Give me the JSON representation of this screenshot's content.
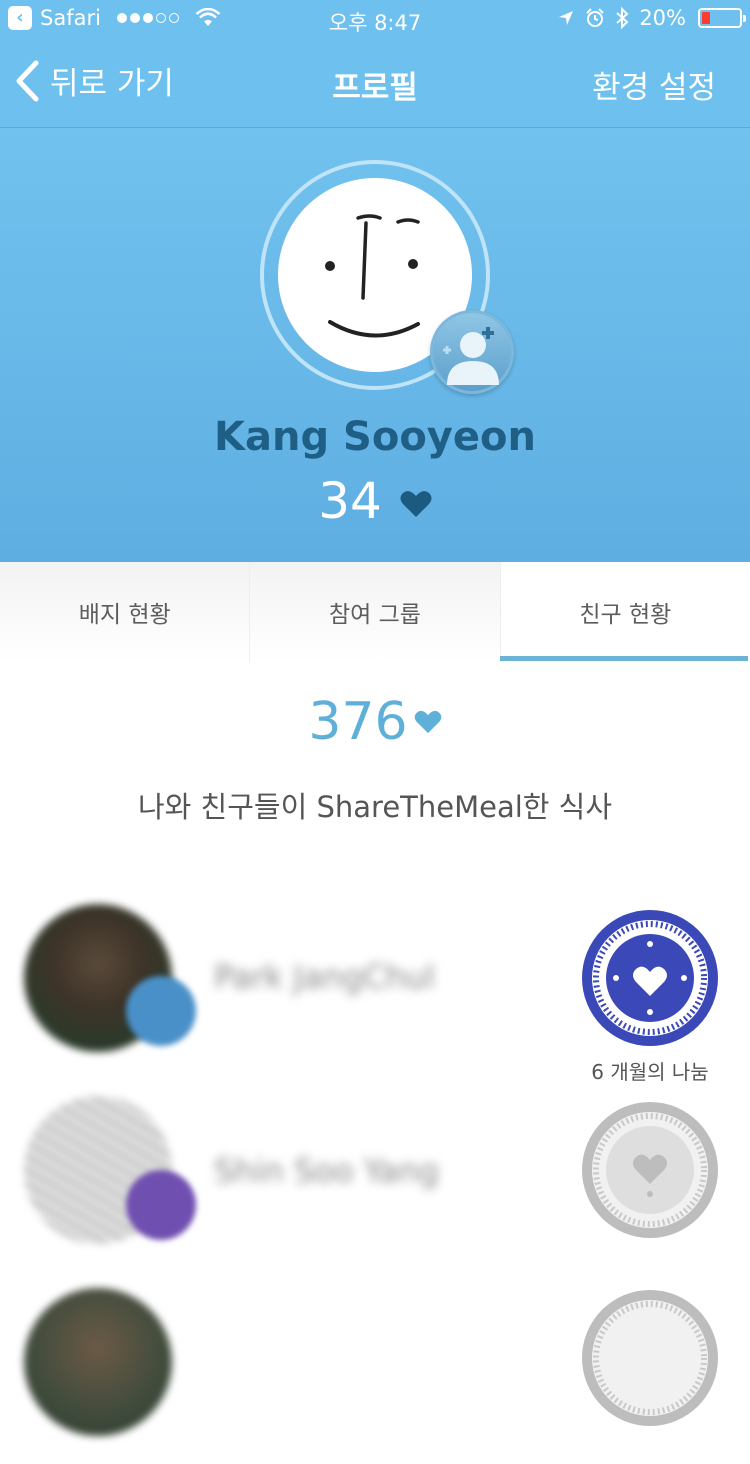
{
  "status_bar": {
    "app": "Safari",
    "time": "오후 8:47",
    "battery": "20%"
  },
  "nav": {
    "back_label": "뒤로 가기",
    "title": "프로필",
    "settings_label": "환경 설정"
  },
  "profile": {
    "name": "Kang Sooyeon",
    "meals": "34"
  },
  "tabs": [
    {
      "label": "배지 현황"
    },
    {
      "label": "참여 그룹"
    },
    {
      "label": "친구 현황"
    }
  ],
  "summary": {
    "total": "376",
    "description": "나와 친구들이 ShareTheMeal한 식사"
  },
  "friends": [
    {
      "name": "Park JangChul",
      "badge_label": "6 개월의 나눔"
    },
    {
      "name": "Shin Soo Yang"
    }
  ],
  "colors": {
    "accent": "#6ec0ee",
    "name_text": "#1f5f86",
    "heart_dark": "#1d5a7f",
    "heart_light": "#5fb0d8",
    "badge_blue": "#3b48b8"
  }
}
